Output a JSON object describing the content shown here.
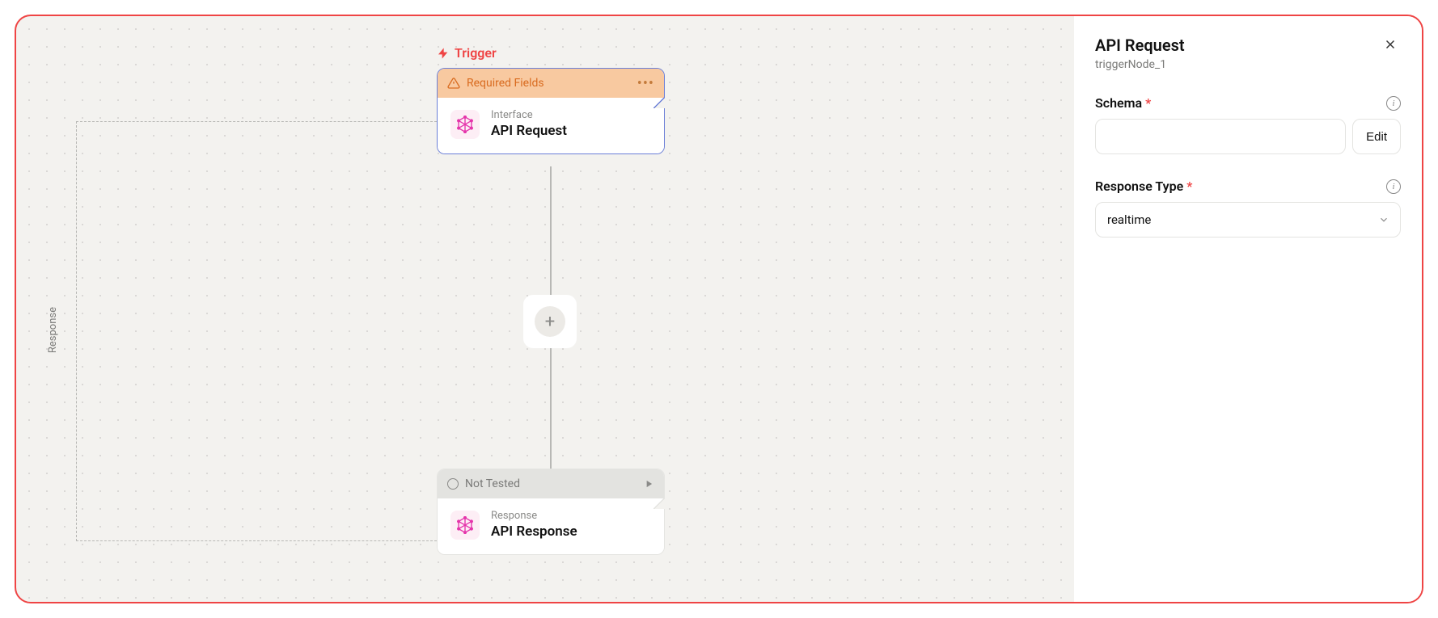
{
  "canvas": {
    "trigger_label": "Trigger",
    "loop_label": "Response",
    "node1": {
      "header_text": "Required Fields",
      "subtitle": "Interface",
      "title": "API Request"
    },
    "node2": {
      "header_text": "Not Tested",
      "subtitle": "Response",
      "title": "API Response"
    }
  },
  "sidebar": {
    "title": "API Request",
    "subtitle": "triggerNode_1",
    "schema": {
      "label": "Schema",
      "edit_button": "Edit",
      "value": ""
    },
    "response_type": {
      "label": "Response Type",
      "value": "realtime"
    }
  }
}
